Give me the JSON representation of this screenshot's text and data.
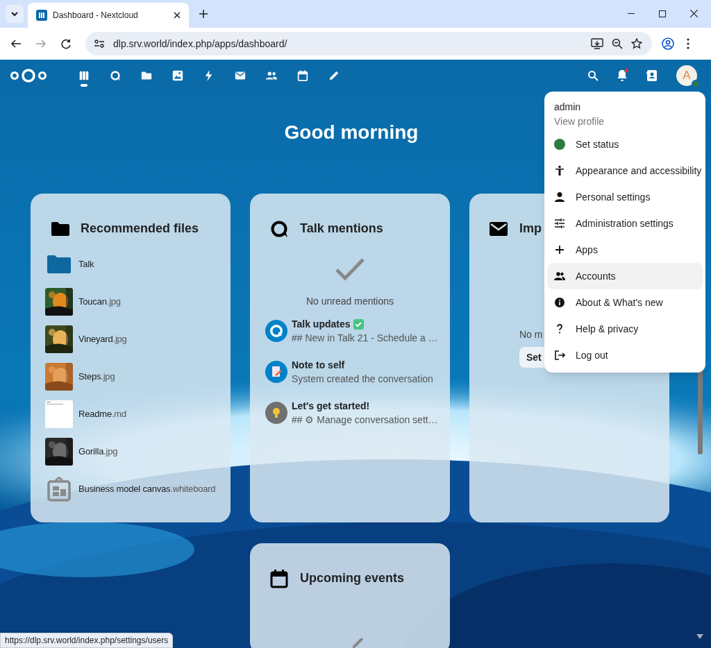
{
  "browser": {
    "tab_title": "Dashboard - Nextcloud",
    "url": "dlp.srv.world/index.php/apps/dashboard/",
    "status_url": "https://dlp.srv.world/index.php/settings/users"
  },
  "header": {
    "apps": [
      {
        "kind": "dashboard",
        "selected": true
      },
      {
        "kind": "talk",
        "selected": false
      },
      {
        "kind": "files",
        "selected": false
      },
      {
        "kind": "photos",
        "selected": false
      },
      {
        "kind": "activity",
        "selected": false
      },
      {
        "kind": "mail",
        "selected": false
      },
      {
        "kind": "contacts",
        "selected": false
      },
      {
        "kind": "calendar",
        "selected": false
      },
      {
        "kind": "notes",
        "selected": false
      }
    ],
    "notification_unread": true,
    "avatar_letter": "A"
  },
  "greeting": "Good morning",
  "widgets": [
    {
      "kind": "files",
      "title": "Recommended files",
      "items": [
        {
          "kind": "folder",
          "name": "Talk"
        },
        {
          "name": "Toucan",
          "ext": ".jpg"
        },
        {
          "name": "Vineyard",
          "ext": ".jpg"
        },
        {
          "name": "Steps",
          "ext": ".jpg"
        },
        {
          "kind": "document",
          "name": "Readme",
          "ext": ".md"
        },
        {
          "name": "Gorilla",
          "ext": ".jpg"
        },
        {
          "kind": "whiteboard",
          "name": "Business model canvas",
          "ext": ".whiteboard"
        }
      ]
    },
    {
      "kind": "talk",
      "title": "Talk mentions",
      "empty_text": "No unread mentions",
      "items": [
        {
          "avatar": {
            "kind": "talk"
          },
          "title": "Talk updates",
          "badge": {
            "kind": "check"
          },
          "subtitle": "## New in Talk 21 - Schedule a …"
        },
        {
          "avatar": {
            "kind": "note"
          },
          "title": "Note to self",
          "subtitle": "System created the conversation"
        },
        {
          "avatar": {
            "kind": "bulb"
          },
          "title": "Let's get started!",
          "subtitle": "## ⚙ Manage conversation sett…"
        }
      ]
    },
    {
      "kind": "mail",
      "title": "Imp",
      "empty_text": "No m",
      "button": "Set"
    },
    {
      "kind": "calendar",
      "title": "Upcoming events"
    }
  ],
  "user_menu": {
    "user": "admin",
    "profile_link": "View profile",
    "items": [
      {
        "kind": "status",
        "label": "Set status",
        "color": "#2d7b41",
        "selected": false
      },
      {
        "kind": "accessibility",
        "label": "Appearance and accessibility",
        "selected": false
      },
      {
        "kind": "person",
        "label": "Personal settings",
        "selected": false
      },
      {
        "kind": "sliders",
        "label": "Administration settings",
        "selected": false
      },
      {
        "kind": "plus",
        "label": "Apps",
        "selected": false
      },
      {
        "kind": "group",
        "label": "Accounts",
        "selected": true
      },
      {
        "kind": "info",
        "label": "About & What's new",
        "selected": false
      },
      {
        "kind": "help",
        "label": "Help & privacy",
        "selected": false
      },
      {
        "kind": "logout",
        "label": "Log out",
        "selected": false
      }
    ]
  }
}
